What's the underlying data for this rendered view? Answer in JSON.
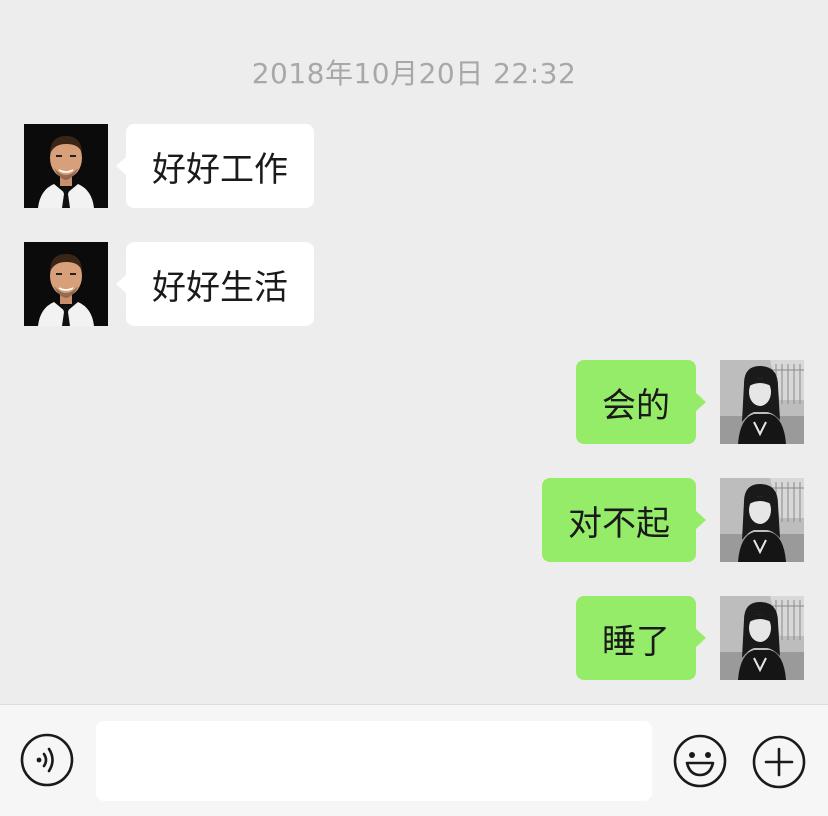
{
  "chat": {
    "timestamp": "2018年10月20日 22:32",
    "messages": [
      {
        "side": "left",
        "text": "好好工作",
        "avatar": "man-portrait"
      },
      {
        "side": "left",
        "text": "好好生活",
        "avatar": "man-portrait"
      },
      {
        "side": "right",
        "text": "会的",
        "avatar": "woman-portrait"
      },
      {
        "side": "right",
        "text": "对不起",
        "avatar": "woman-portrait"
      },
      {
        "side": "right",
        "text": "睡了",
        "avatar": "woman-portrait"
      }
    ]
  },
  "input_bar": {
    "voice_icon": "voice-icon",
    "text_value": "",
    "emoji_icon": "emoji-icon",
    "plus_icon": "plus-icon"
  },
  "colors": {
    "background": "#ededed",
    "incoming_bubble": "#ffffff",
    "outgoing_bubble": "#95ec69",
    "timestamp": "#a8a8a8"
  }
}
